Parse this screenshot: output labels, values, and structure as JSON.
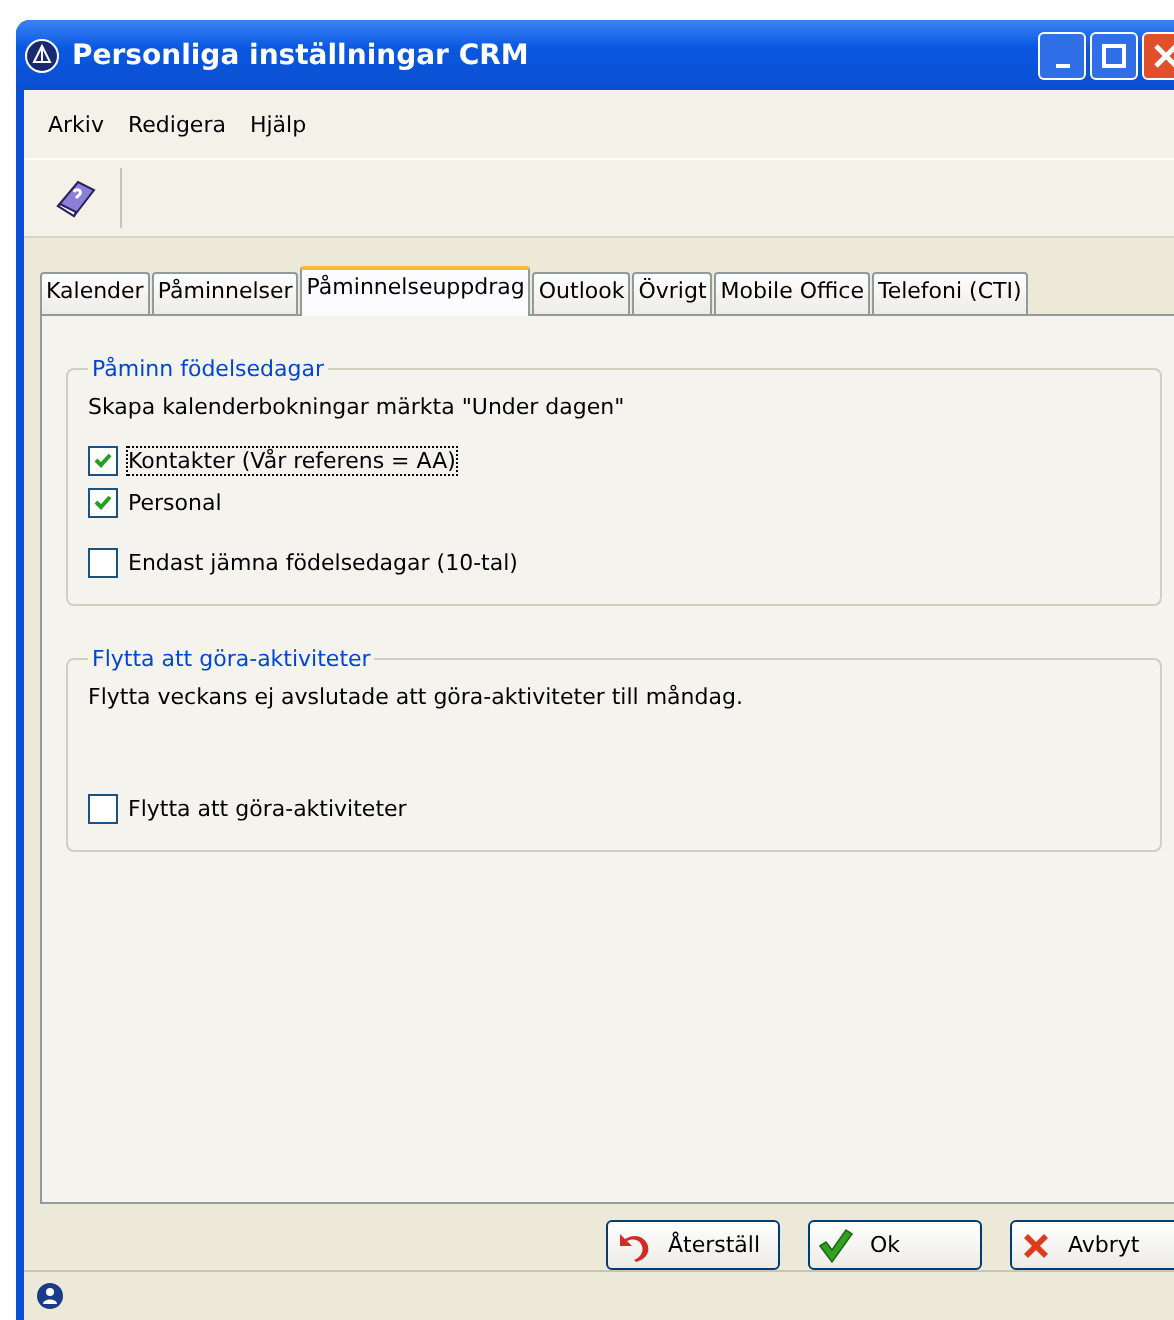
{
  "window": {
    "title": "Personliga inställningar CRM"
  },
  "menu": [
    "Arkiv",
    "Redigera",
    "Hjälp"
  ],
  "tabs": [
    {
      "label": "Kalender",
      "selected": false
    },
    {
      "label": "Påminnelser",
      "selected": false
    },
    {
      "label": "Påminnelseuppdrag",
      "selected": true
    },
    {
      "label": "Outlook",
      "selected": false
    },
    {
      "label": "Övrigt",
      "selected": false
    },
    {
      "label": "Mobile Office",
      "selected": false
    },
    {
      "label": "Telefoni (CTI)",
      "selected": false
    }
  ],
  "groups": [
    {
      "title": "Påminn födelsedagar",
      "description": "Skapa kalenderbokningar märkta \"Under dagen\"",
      "options": [
        {
          "label": "Kontakter (Vår referens = AA)",
          "checked": true,
          "focused": true
        },
        {
          "label": "Personal",
          "checked": true,
          "focused": false
        },
        {
          "label": "Endast jämna födelsedagar (10-tal)",
          "checked": false,
          "focused": false
        }
      ]
    },
    {
      "title": "Flytta att göra-aktiviteter",
      "description": "Flytta veckans ej avslutade att göra-aktiviteter till måndag.",
      "options": [
        {
          "label": "Flytta att göra-aktiviteter",
          "checked": false,
          "focused": false
        }
      ]
    }
  ],
  "buttons": [
    {
      "label": "Återställ",
      "kind": "reset"
    },
    {
      "label": "Ok",
      "kind": "ok"
    },
    {
      "label": "Avbryt",
      "kind": "cancel"
    }
  ]
}
